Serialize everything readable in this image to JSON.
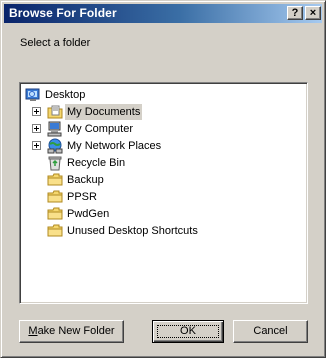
{
  "window": {
    "title": "Browse For Folder",
    "help_glyph": "?",
    "close_glyph": "×"
  },
  "prompt": "Select a folder",
  "tree": {
    "items": [
      {
        "label": "Desktop",
        "icon": "desktop-icon",
        "expandable": false,
        "selected": false,
        "level": 0
      },
      {
        "label": "My Documents",
        "icon": "my-documents-icon",
        "expandable": true,
        "selected": true,
        "level": 1
      },
      {
        "label": "My Computer",
        "icon": "my-computer-icon",
        "expandable": true,
        "selected": false,
        "level": 1
      },
      {
        "label": "My Network Places",
        "icon": "network-places-icon",
        "expandable": true,
        "selected": false,
        "level": 1
      },
      {
        "label": "Recycle Bin",
        "icon": "recycle-bin-icon",
        "expandable": false,
        "selected": false,
        "level": 1
      },
      {
        "label": "Backup",
        "icon": "folder-icon",
        "expandable": false,
        "selected": false,
        "level": 1
      },
      {
        "label": "PPSR",
        "icon": "folder-icon",
        "expandable": false,
        "selected": false,
        "level": 1
      },
      {
        "label": "PwdGen",
        "icon": "folder-icon",
        "expandable": false,
        "selected": false,
        "level": 1
      },
      {
        "label": "Unused Desktop Shortcuts",
        "icon": "folder-icon",
        "expandable": false,
        "selected": false,
        "level": 1
      }
    ]
  },
  "buttons": {
    "new_folder_accel": "M",
    "new_folder_rest": "ake New Folder",
    "ok": "OK",
    "cancel": "Cancel"
  },
  "colors": {
    "title_gradient_start": "#0a246a",
    "title_gradient_end": "#a6caf0",
    "face": "#d4d0c8",
    "folder_yellow": "#f5d76e"
  }
}
